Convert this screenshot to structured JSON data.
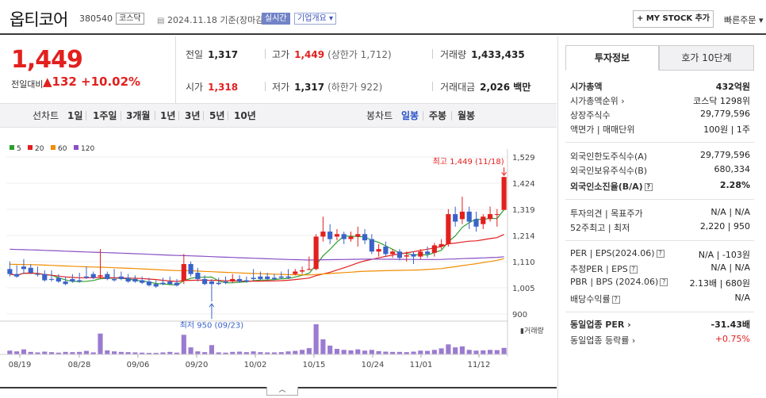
{
  "header": {
    "stock_name": "옵티코어",
    "stock_code": "380540",
    "market": "코스닥",
    "date": "2024.11.18 기준(장마감)",
    "realtime_label": "실시간",
    "overview_label": "기업개요 ▾",
    "my_stock_label": "+ MY STOCK 추가",
    "quick_order_label": "빠른주문 ▾"
  },
  "price": {
    "current": "1,449",
    "prev_diff_label": "전일대비",
    "diff": "▲132",
    "diff_pct": "+10.02%"
  },
  "stats": {
    "prev_close_label": "전일",
    "prev_close": "1,317",
    "high_label": "고가",
    "high": "1,449",
    "high_sub": "(상한가 1,712)",
    "volume_label": "거래량",
    "volume": "1,433,435",
    "open_label": "시가",
    "open": "1,318",
    "low_label": "저가",
    "low": "1,317",
    "low_sub": "(하한가 922)",
    "amount_label": "거래대금",
    "amount": "2,026 백만"
  },
  "period_bar": {
    "compare_label": "선차트",
    "periods": [
      "1일",
      "1주일",
      "3개월",
      "1년",
      "3년",
      "5년",
      "10년"
    ],
    "type_label": "봉차트",
    "candle_types": [
      "일봉",
      "주봉",
      "월봉"
    ],
    "active_candle": "일봉"
  },
  "chart_data": {
    "type": "candlestick",
    "legend": [
      {
        "name": "5",
        "color": "#2ca02c"
      },
      {
        "name": "20",
        "color": "#e2201e"
      },
      {
        "name": "60",
        "color": "#f28c00"
      },
      {
        "name": "120",
        "color": "#8a4fc6"
      }
    ],
    "y_ticks": [
      "1,529",
      "1,424",
      "1,319",
      "1,214",
      "1,110",
      "1,005",
      "900"
    ],
    "ylim": [
      900,
      1529
    ],
    "x_ticks": [
      "08/19",
      "08/28",
      "09/06",
      "09/20",
      "10/02",
      "10/15",
      "10/24",
      "11/01",
      "11/12"
    ],
    "high_annotation": "최고 1,449 (11/18)",
    "low_annotation": "최저 950 (09/23)",
    "volume_label": "거래량",
    "up_color": "#e2201e",
    "down_color": "#3a62c9",
    "candles": [
      [
        1080,
        1110,
        1060,
        1050
      ],
      [
        1060,
        1095,
        1050,
        1045
      ],
      [
        1090,
        1120,
        1080,
        1060
      ],
      [
        1085,
        1100,
        1065,
        1060
      ],
      [
        1060,
        1090,
        1058,
        1050
      ],
      [
        1060,
        1075,
        1035,
        1030
      ],
      [
        1040,
        1075,
        1038,
        1030
      ],
      [
        1045,
        1060,
        1030,
        1025
      ],
      [
        1030,
        1050,
        1020,
        1015
      ],
      [
        1040,
        1060,
        1030,
        1025
      ],
      [
        1035,
        1065,
        1030,
        1025
      ],
      [
        1050,
        1090,
        1045,
        1040
      ],
      [
        1060,
        1070,
        1045,
        1040
      ],
      [
        1050,
        1160,
        1055,
        1040
      ],
      [
        1060,
        1070,
        1040,
        1035
      ],
      [
        1040,
        1080,
        1035,
        1030
      ],
      [
        1050,
        1070,
        1040,
        1035
      ],
      [
        1045,
        1060,
        1030,
        1025
      ],
      [
        1040,
        1055,
        1030,
        1025
      ],
      [
        1035,
        1050,
        1025,
        1020
      ],
      [
        1030,
        1045,
        1015,
        1010
      ],
      [
        1020,
        1035,
        1010,
        1005
      ],
      [
        1025,
        1045,
        1020,
        1015
      ],
      [
        1030,
        1050,
        1020,
        1015
      ],
      [
        1025,
        1040,
        1015,
        1010
      ],
      [
        1035,
        1140,
        1100,
        1020
      ],
      [
        1100,
        1110,
        1060,
        1050
      ],
      [
        1065,
        1085,
        1040,
        1030
      ],
      [
        1040,
        1055,
        1020,
        1015
      ],
      [
        1030,
        1040,
        1020,
        950
      ],
      [
        1025,
        1045,
        1020,
        1015
      ],
      [
        1030,
        1050,
        1025,
        1020
      ],
      [
        1030,
        1060,
        1040,
        1025
      ],
      [
        1040,
        1055,
        1030,
        1025
      ],
      [
        1035,
        1050,
        1030,
        1025
      ],
      [
        1045,
        1080,
        1040,
        1035
      ],
      [
        1050,
        1070,
        1040,
        1035
      ],
      [
        1050,
        1065,
        1040,
        1035
      ],
      [
        1045,
        1060,
        1040,
        1035
      ],
      [
        1050,
        1070,
        1045,
        1040
      ],
      [
        1050,
        1080,
        1045,
        1040
      ],
      [
        1060,
        1080,
        1070,
        1055
      ],
      [
        1070,
        1090,
        1075,
        1060
      ],
      [
        1080,
        1130,
        1080,
        1075
      ],
      [
        1080,
        1220,
        1210,
        1075
      ],
      [
        1210,
        1290,
        1230,
        1190
      ],
      [
        1230,
        1260,
        1200,
        1180
      ],
      [
        1210,
        1240,
        1220,
        1195
      ],
      [
        1220,
        1230,
        1200,
        1180
      ],
      [
        1200,
        1230,
        1210,
        1190
      ],
      [
        1210,
        1250,
        1220,
        1170
      ],
      [
        1220,
        1240,
        1195,
        1180
      ],
      [
        1200,
        1220,
        1150,
        1140
      ],
      [
        1150,
        1180,
        1160,
        1130
      ],
      [
        1170,
        1190,
        1140,
        1130
      ],
      [
        1140,
        1160,
        1150,
        1125
      ],
      [
        1150,
        1160,
        1125,
        1115
      ],
      [
        1130,
        1150,
        1135,
        1110
      ],
      [
        1140,
        1150,
        1130,
        1100
      ],
      [
        1130,
        1160,
        1150,
        1120
      ],
      [
        1150,
        1170,
        1140,
        1125
      ],
      [
        1145,
        1185,
        1175,
        1130
      ],
      [
        1170,
        1200,
        1180,
        1160
      ],
      [
        1180,
        1320,
        1300,
        1170
      ],
      [
        1300,
        1330,
        1270,
        1250
      ],
      [
        1280,
        1370,
        1310,
        1260
      ],
      [
        1310,
        1330,
        1270,
        1240
      ],
      [
        1280,
        1310,
        1250,
        1230
      ],
      [
        1260,
        1300,
        1290,
        1240
      ],
      [
        1280,
        1330,
        1300,
        1270
      ],
      [
        1300,
        1320,
        1300,
        1250
      ],
      [
        1317,
        1449,
        1449,
        1317
      ]
    ],
    "volumes": [
      1.5,
      1.2,
      2.0,
      1.0,
      0.8,
      1.1,
      0.9,
      0.7,
      1.0,
      0.9,
      1.0,
      1.4,
      0.8,
      8.3,
      1.6,
      1.2,
      1.0,
      0.9,
      0.8,
      0.7,
      0.6,
      0.6,
      0.8,
      1.0,
      0.7,
      7.8,
      2.8,
      1.2,
      0.9,
      3.7,
      0.8,
      0.7,
      1.0,
      1.1,
      0.9,
      1.2,
      0.9,
      0.8,
      0.8,
      0.9,
      1.2,
      1.4,
      1.8,
      2.5,
      12.0,
      6.0,
      3.5,
      2.2,
      1.8,
      1.6,
      2.0,
      1.5,
      1.8,
      1.3,
      1.1,
      1.0,
      1.0,
      0.9,
      1.1,
      1.5,
      1.4,
      1.8,
      2.4,
      4.0,
      2.8,
      3.2,
      1.8,
      1.5,
      1.6,
      1.8,
      1.7,
      2.6
    ]
  },
  "right_panel": {
    "tab_invest": "투자정보",
    "tab_hoga": "호가 10단계",
    "group1": [
      {
        "label": "시가총액",
        "value": "432억원",
        "bold": true
      },
      {
        "label": "시가총액순위 ›",
        "value": "코스닥 1298위"
      },
      {
        "label": "상장주식수",
        "value": "29,779,596"
      },
      {
        "label": "액면가 | 매매단위",
        "value": "100원 | 1주"
      }
    ],
    "group2": [
      {
        "label": "외국인한도주식수(A)",
        "value": "29,779,596"
      },
      {
        "label": "외국인보유주식수(B)",
        "value": "680,334"
      },
      {
        "label": "외국인소진율(B/A)",
        "value": "2.28%",
        "bold": true
      }
    ],
    "group3": [
      {
        "label": "투자의견 | 목표주가",
        "value": "N/A | N/A"
      },
      {
        "label": "52주최고 | 최저",
        "value": "2,220 | 950"
      }
    ],
    "group4": [
      {
        "label": "PER | EPS(2024.06)",
        "value": "N/A | -103원"
      },
      {
        "label": "추정PER | EPS",
        "value": "N/A | N/A"
      },
      {
        "label": "PBR | BPS (2024.06)",
        "value": "2.13배 | 680원"
      },
      {
        "label": "배당수익률",
        "value": "N/A"
      }
    ],
    "group5": [
      {
        "label": "동일업종 PER ›",
        "value": "-31.43배",
        "bold": true
      },
      {
        "label": "동일업종 등락률 ›",
        "value": "+0.75%",
        "red": true
      }
    ]
  }
}
